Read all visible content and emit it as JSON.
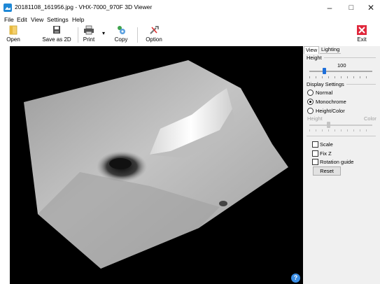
{
  "window": {
    "title": "20181108_161956.jpg - VHX-7000_970F 3D Viewer",
    "buttons": {
      "minimize": "–",
      "maximize": "□",
      "close": "✕"
    }
  },
  "menu": {
    "items": [
      {
        "label": "File"
      },
      {
        "label": "Edit"
      },
      {
        "label": "View"
      },
      {
        "label": "Settings"
      },
      {
        "label": "Help"
      }
    ]
  },
  "toolbar": {
    "open_label": "Open",
    "save2d_label": "Save as 2D",
    "print_label": "Print",
    "copy_label": "Copy",
    "option_label": "Option",
    "exit_label": "Exit",
    "accent_exit": "#e0283c"
  },
  "viewer": {
    "help_label": "?",
    "background": "#000000"
  },
  "panel": {
    "tabs": [
      {
        "label": "View",
        "active": true
      },
      {
        "label": "Lighting",
        "active": false
      }
    ],
    "height_group": {
      "label": "Height",
      "value": "100"
    },
    "display_group": {
      "label": "Display Settings",
      "options": [
        {
          "label": "Normal",
          "selected": false
        },
        {
          "label": "Monochrome",
          "selected": true
        },
        {
          "label": "Height/Color",
          "selected": false
        }
      ],
      "slider_left_label": "Height",
      "slider_right_label": "Color"
    },
    "checkboxes": [
      {
        "label": "Scale",
        "checked": false
      },
      {
        "label": "Fix Z",
        "checked": false
      },
      {
        "label": "Rotation guide",
        "checked": false
      }
    ],
    "reset_label": "Reset"
  }
}
